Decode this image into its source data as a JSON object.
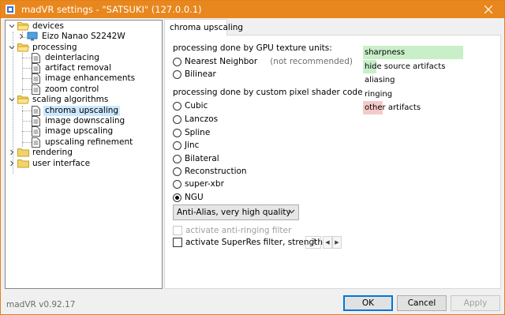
{
  "window": {
    "title": "madVR settings - \"SATSUKI\" (127.0.0.1)"
  },
  "tree": {
    "devices": "devices",
    "device_monitor": "Eizo Nanao S2242W",
    "processing": "processing",
    "deinterlacing": "deinterlacing",
    "artifact_removal": "artifact removal",
    "image_enhancements": "image enhancements",
    "zoom_control": "zoom control",
    "scaling_algorithms": "scaling algorithms",
    "chroma_upscaling": "chroma upscaling",
    "image_downscaling": "image downscaling",
    "image_upscaling": "image upscaling",
    "upscaling_refinement": "upscaling refinement",
    "rendering": "rendering",
    "user_interface": "user interface"
  },
  "tab": {
    "label": "chroma upscaling"
  },
  "gpu_section": {
    "label": "processing done by GPU texture units:",
    "nearest_neighbor": "Nearest Neighbor",
    "nearest_note": "(not recommended)",
    "bilinear": "Bilinear"
  },
  "shader_section": {
    "label": "processing done by custom pixel shader code:",
    "options": [
      "Cubic",
      "Lanczos",
      "Spline",
      "Jinc",
      "Bilateral",
      "Reconstruction",
      "super-xbr",
      "NGU"
    ],
    "selected": "NGU"
  },
  "quality_combo": {
    "value": "Anti-Alias, very high quality"
  },
  "anti_ringing": {
    "label": "activate anti-ringing filter"
  },
  "superres": {
    "label": "activate SuperRes filter, strength:",
    "strength": "3"
  },
  "legend": {
    "rows": [
      {
        "label": "sharpness",
        "color": "#c9efc9",
        "level": 0.97
      },
      {
        "label": "hide source artifacts",
        "color": "#c9efc9",
        "level": 0.13
      },
      {
        "label": "aliasing",
        "color": "#c9efc9",
        "level": 0
      },
      {
        "label": "ringing",
        "color": "#c9efc9",
        "level": 0
      },
      {
        "label": "other artifacts",
        "color": "#f6c9c9",
        "level": 0.19
      }
    ]
  },
  "footer": {
    "version": "madVR v0.92.17",
    "ok": "OK",
    "cancel": "Cancel",
    "apply": "Apply"
  },
  "colors": {
    "titlebar": "#e8871e",
    "selection": "#cce8ff",
    "default_button_border": "#0078d7"
  }
}
